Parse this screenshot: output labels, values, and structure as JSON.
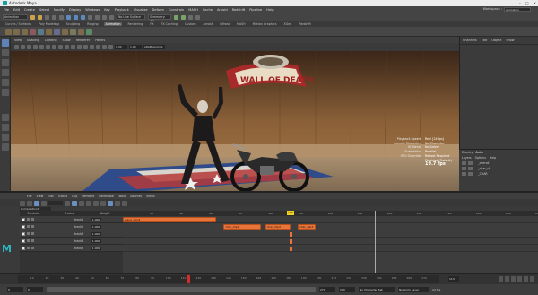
{
  "window": {
    "title": "Autodesk Maya"
  },
  "menubar": {
    "items": [
      "File",
      "Edit",
      "Create",
      "Select",
      "Modify",
      "Display",
      "Windows",
      "Key",
      "Playback",
      "Visualize",
      "Deform",
      "Constrain",
      "MASH",
      "Cache",
      "Arnold",
      "Redshift",
      "Pipeline",
      "Help"
    ],
    "workspace_label": "Workspace :",
    "workspace_value": "Animation"
  },
  "statusline": {
    "mode": "Animation",
    "live_surface": "No Live Surface",
    "symmetry": "Symmetry: Off"
  },
  "shelf_tabs": [
    "Curves / Surfaces",
    "Poly Modeling",
    "Sculpting",
    "Rigging",
    "Animation",
    "Rendering",
    "FX",
    "FX Caching",
    "Custom",
    "Arnold",
    "Bifrost",
    "MASH",
    "Motion Graphics",
    "XGen",
    "Redshift"
  ],
  "shelf_active_tab": "Animation",
  "viewport": {
    "menu": [
      "View",
      "Shading",
      "Lighting",
      "Show",
      "Renderer",
      "Panels"
    ],
    "near": "0.00",
    "far": "1.00",
    "color_space": "sRGB gamma",
    "sign_text": "WALL OF DEATH",
    "hud": [
      {
        "k": "Playback Speed:",
        "v": "Real [24 fps]"
      },
      {
        "k": "Current Character:",
        "v": "No Character"
      },
      {
        "k": "IK Blend:",
        "v": "No Solver"
      },
      {
        "k": "Evaluation:",
        "v": "Parallel"
      },
      {
        "k": "GPU Override:",
        "v": "Reboot Required"
      },
      {
        "k": "",
        "v": "Disabled (Default)"
      }
    ],
    "fps": "19.7 fps"
  },
  "channelbox": {
    "menu": [
      "Channels",
      "Edit",
      "Object",
      "Show"
    ]
  },
  "layers": {
    "tabs": [
      "Display",
      "Anim"
    ],
    "active_tab": "Anim",
    "menu": [
      "Layers",
      "Options",
      "Help"
    ],
    "rows": [
      "_overall",
      "_char_ctl",
      "_CHAR"
    ]
  },
  "timeeditor": {
    "menu": [
      "File",
      "View",
      "Edit",
      "Tracks",
      "Clip",
      "Reframe",
      "Retimable",
      "Tools",
      "Sources",
      "Views"
    ],
    "composition": "Composition1",
    "tracks_header": [
      "Controls",
      "Tracks",
      "Weight"
    ],
    "tracks": [
      {
        "name": "track1",
        "weight": "1.000"
      },
      {
        "name": "track2",
        "weight": "1.000"
      },
      {
        "name": "track3",
        "weight": "1.000"
      },
      {
        "name": "track4",
        "weight": "1.000"
      },
      {
        "name": "track5",
        "weight": "1.000"
      }
    ],
    "ruler_ticks": [
      "20",
      "40",
      "60",
      "80",
      "100",
      "120",
      "140",
      "160",
      "180",
      "200",
      "220",
      "240",
      "260",
      "280"
    ],
    "playhead_frame": "113",
    "clips": [
      {
        "label": "wave_sign1"
      },
      {
        "label": "char_clip1"
      },
      {
        "label": "char_clip2"
      },
      {
        "label": "char_clip3"
      }
    ]
  },
  "timeslider": {
    "ticks": [
      "10",
      "20",
      "30",
      "40",
      "50",
      "60",
      "70",
      "80",
      "90",
      "100",
      "110",
      "120",
      "130",
      "140",
      "150",
      "160",
      "170",
      "180",
      "190",
      "200",
      "210",
      "220",
      "230",
      "240",
      "250",
      "260",
      "270"
    ],
    "current_frame": "113",
    "total_frames": 280
  },
  "rangeslider": {
    "start": "0",
    "range_start": "0",
    "range_end": "270",
    "end": "270",
    "character": "No Character Set",
    "anim_layer": "No Anim Layer",
    "fps": "24 fps"
  }
}
